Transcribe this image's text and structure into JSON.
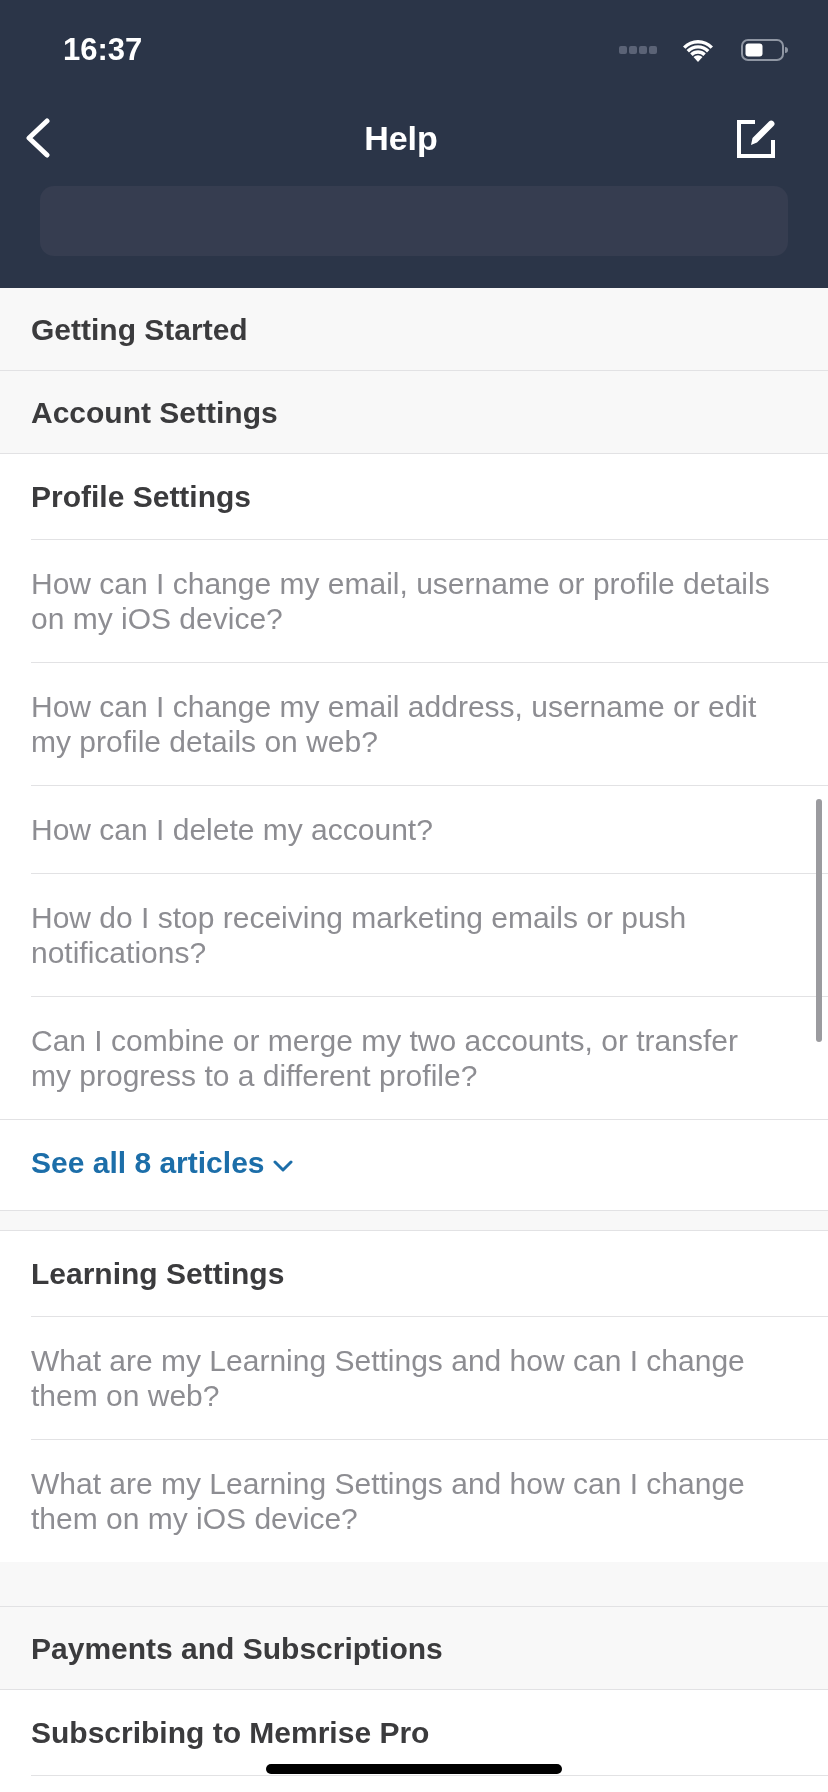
{
  "status_bar": {
    "time": "16:37"
  },
  "nav_bar": {
    "title": "Help"
  },
  "categories": [
    {
      "title": "Getting Started"
    },
    {
      "title": "Account Settings",
      "sections": [
        {
          "title": "Profile Settings",
          "articles": [
            "How can I change my email, username or profile details on my iOS device?",
            "How can I change my email address, username or edit my profile details on web?",
            "How can I delete my account?",
            "How do I stop receiving marketing emails or push notifications?",
            "Can I combine or merge my two accounts, or transfer my progress to a different profile?"
          ],
          "see_all": "See all 8 articles"
        },
        {
          "title": "Learning Settings",
          "articles": [
            "What are my Learning Settings and how can I change them on web?",
            "What are my Learning Settings and how can I change them on my iOS device?"
          ]
        }
      ]
    },
    {
      "title": "Payments and Subscriptions",
      "sections": [
        {
          "title": "Subscribing to Memrise Pro"
        }
      ]
    }
  ]
}
